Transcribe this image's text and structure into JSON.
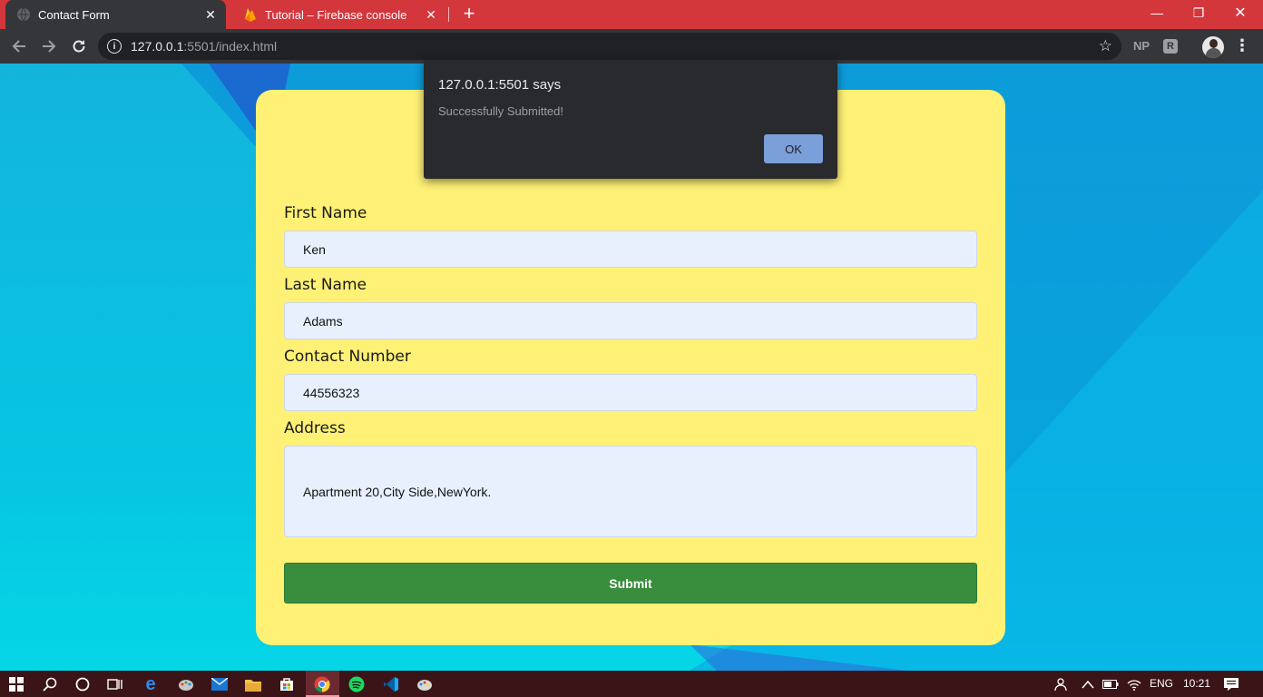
{
  "browser": {
    "tabs": [
      {
        "title": "Contact Form",
        "active": true
      },
      {
        "title": "Tutorial – Firebase console",
        "active": false
      }
    ],
    "url_host": "127.0.0.1",
    "url_rest": ":5501/index.html",
    "extensions": [
      "NP",
      "R"
    ]
  },
  "form": {
    "fields": [
      {
        "label": "First Name",
        "value": "Ken"
      },
      {
        "label": "Last Name",
        "value": "Adams"
      },
      {
        "label": "Contact Number",
        "value": "44556323"
      },
      {
        "label": "Address",
        "value": "Apartment 20,City Side,NewYork."
      }
    ],
    "submit_label": "Submit"
  },
  "alert": {
    "title": "127.0.0.1:5501 says",
    "message": "Successfully Submitted!",
    "ok_label": "OK"
  },
  "taskbar": {
    "language": "ENG",
    "time": "10:21"
  },
  "colors": {
    "tab_bar": "#d3363b",
    "card": "#fff176",
    "submit": "#388e3c",
    "dialog_button": "#8ab4f8"
  }
}
